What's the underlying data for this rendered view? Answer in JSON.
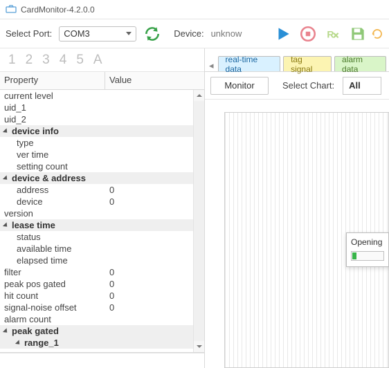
{
  "window": {
    "title": "CardMonitor-4.2.0.0"
  },
  "toolbar": {
    "selectPortLabel": "Select Port:",
    "portValue": "COM3",
    "deviceLabel": "Device:",
    "deviceValue": "unknow"
  },
  "numTabs": [
    "1",
    "2",
    "3",
    "4",
    "5",
    "A"
  ],
  "grid": {
    "header": {
      "property": "Property",
      "value": "Value"
    },
    "rows": [
      {
        "type": "plain",
        "prop": "current level",
        "val": ""
      },
      {
        "type": "plain",
        "prop": "uid_1",
        "val": ""
      },
      {
        "type": "plain",
        "prop": "uid_2",
        "val": ""
      },
      {
        "type": "group",
        "prop": "device info"
      },
      {
        "type": "child",
        "prop": "type",
        "val": ""
      },
      {
        "type": "child",
        "prop": "ver time",
        "val": ""
      },
      {
        "type": "child",
        "prop": "setting count",
        "val": ""
      },
      {
        "type": "group",
        "prop": "device & address"
      },
      {
        "type": "child",
        "prop": "address",
        "val": "0"
      },
      {
        "type": "child",
        "prop": "device",
        "val": "0"
      },
      {
        "type": "plain",
        "prop": "version",
        "val": ""
      },
      {
        "type": "group",
        "prop": "lease time"
      },
      {
        "type": "child",
        "prop": "status",
        "val": ""
      },
      {
        "type": "child",
        "prop": "available time",
        "val": ""
      },
      {
        "type": "child",
        "prop": "elapsed time",
        "val": ""
      },
      {
        "type": "plain",
        "prop": "filter",
        "val": "0"
      },
      {
        "type": "plain",
        "prop": "peak pos gated",
        "val": "0"
      },
      {
        "type": "plain",
        "prop": "hit count",
        "val": "0"
      },
      {
        "type": "plain",
        "prop": "signal-noise offset",
        "val": "0"
      },
      {
        "type": "plain",
        "prop": "alarm count",
        "val": ""
      },
      {
        "type": "group",
        "prop": "peak gated"
      },
      {
        "type": "gchild-group",
        "prop": "range_1"
      }
    ]
  },
  "tabs": {
    "realtime": "real-time data",
    "tag": "tag signal",
    "alarm": "alarm data"
  },
  "subbar": {
    "monitor": "Monitor",
    "selectChart": "Select Chart:",
    "chartValue": "All"
  },
  "popup": {
    "label": "Opening d"
  }
}
